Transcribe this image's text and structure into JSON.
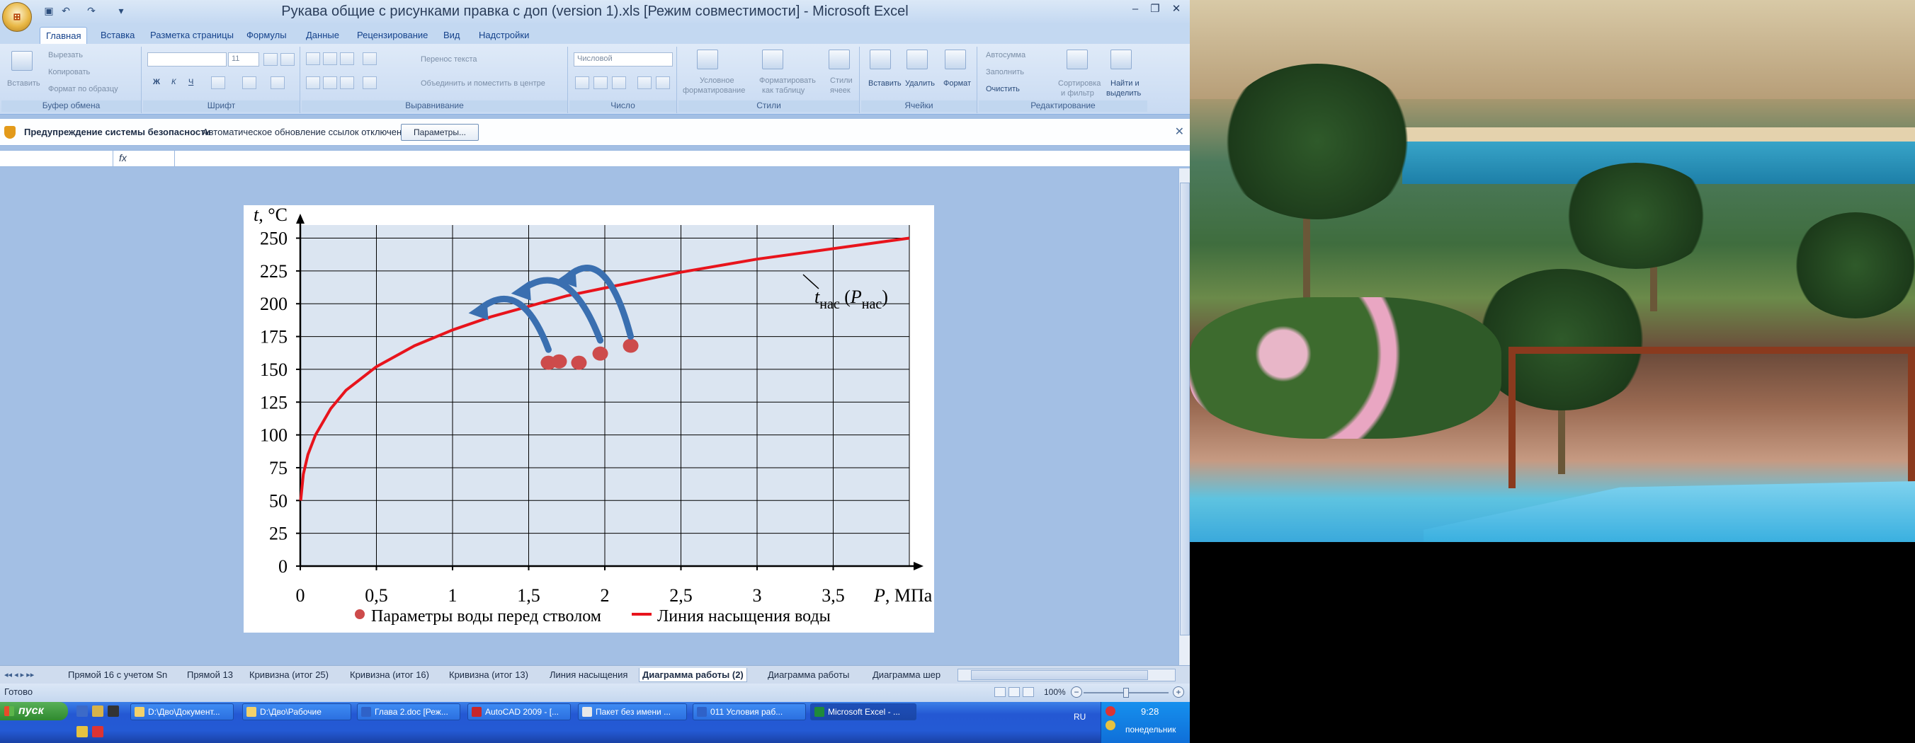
{
  "window": {
    "title": "Рукава общие с рисунками правка с доп (version 1).xls  [Режим совместимости] - Microsoft Excel"
  },
  "ribbon": {
    "tabs": [
      "Главная",
      "Вставка",
      "Разметка страницы",
      "Формулы",
      "Данные",
      "Рецензирование",
      "Вид",
      "Надстройки"
    ],
    "active_tab": "Главная",
    "clipboard": {
      "paste": "Вставить",
      "cut": "Вырезать",
      "copy": "Копировать",
      "format_painter": "Формат по образцу",
      "label": "Буфер обмена"
    },
    "font": {
      "size": "11",
      "bold": "Ж",
      "italic": "К",
      "underline": "Ч",
      "label": "Шрифт"
    },
    "alignment": {
      "wrap": "Перенос текста",
      "merge": "Объединить и поместить в центре",
      "label": "Выравнивание"
    },
    "number": {
      "format": "Числовой",
      "label": "Число"
    },
    "styles": {
      "conditional": "Условное",
      "conditional2": "форматирование",
      "as_table": "Форматировать",
      "as_table2": "как таблицу",
      "cell_styles": "Стили",
      "cell_styles2": "ячеек",
      "label": "Стили"
    },
    "cells": {
      "insert": "Вставить",
      "delete": "Удалить",
      "format": "Формат",
      "label": "Ячейки"
    },
    "editing": {
      "autosum": "Автосумма",
      "fill": "Заполнить",
      "clear": "Очистить",
      "sort": "Сортировка",
      "sort2": "и фильтр",
      "find": "Найти и",
      "find2": "выделить",
      "label": "Редактирование"
    }
  },
  "security_bar": {
    "title": "Предупреждение системы безопасности",
    "message": "Автоматическое обновление ссылок отключено",
    "button": "Параметры..."
  },
  "formula_bar": {
    "fx": "fx"
  },
  "chart_data": {
    "type": "line",
    "ylabel": "t, °C",
    "xlabel": "P, МПа",
    "xlim": [
      0,
      4
    ],
    "ylim": [
      0,
      260
    ],
    "x_ticks": [
      "0",
      "0,5",
      "1",
      "1,5",
      "2",
      "2,5",
      "3",
      "3,5"
    ],
    "y_ticks": [
      "0",
      "25",
      "50",
      "75",
      "100",
      "125",
      "150",
      "175",
      "200",
      "225",
      "250"
    ],
    "series": [
      {
        "name": "Линия насыщения воды",
        "type": "line",
        "color": "#e8141c",
        "points": [
          [
            0.003,
            50
          ],
          [
            0.02,
            70
          ],
          [
            0.05,
            85
          ],
          [
            0.1,
            100
          ],
          [
            0.2,
            120
          ],
          [
            0.3,
            134
          ],
          [
            0.5,
            152
          ],
          [
            0.75,
            168
          ],
          [
            1.0,
            180
          ],
          [
            1.25,
            190
          ],
          [
            1.5,
            198
          ],
          [
            1.75,
            206
          ],
          [
            2.0,
            212
          ],
          [
            2.5,
            224
          ],
          [
            3.0,
            234
          ],
          [
            3.5,
            242
          ],
          [
            4.0,
            250
          ]
        ]
      },
      {
        "name": "Параметры воды перед стволом",
        "type": "scatter",
        "color": "#cd4b4b",
        "points": [
          [
            1.63,
            155
          ],
          [
            1.7,
            156
          ],
          [
            1.83,
            155
          ],
          [
            1.97,
            162
          ],
          [
            2.17,
            168
          ]
        ]
      }
    ],
    "annotation": {
      "main": "t",
      "sub1": "нас",
      "mid": " (",
      "p": "P",
      "sub2": "нас",
      "close": ")"
    },
    "arrow_color": "#3a6fb0",
    "grid": true,
    "legend": "bottom"
  },
  "sheet_tabs": [
    "Прямой 16 с учетом Sn",
    "Прямой 13",
    "Кривизна (итог 25)",
    "Кривизна (итог 16)",
    "Кривизна (итог 13)",
    "Линия насыщения",
    "Диаграмма работы (2)",
    "Диаграмма работы",
    "Диаграмма шер"
  ],
  "active_sheet": "Диаграмма работы (2)",
  "status": {
    "ready": "Готово",
    "zoom": "100%"
  },
  "taskbar": {
    "start": "пуск",
    "tasks": [
      "D:\\Дво\\Документ...",
      "D:\\Дво\\Рабочие",
      "Глава 2.doc [Реж...",
      "AutoCAD 2009 - [...",
      "Пакет без имени ...",
      "011 Условия раб...",
      "Microsoft Excel - ..."
    ],
    "active_task": "Microsoft Excel - ...",
    "lang": "RU",
    "time": "9:28",
    "day": "понедельник"
  }
}
